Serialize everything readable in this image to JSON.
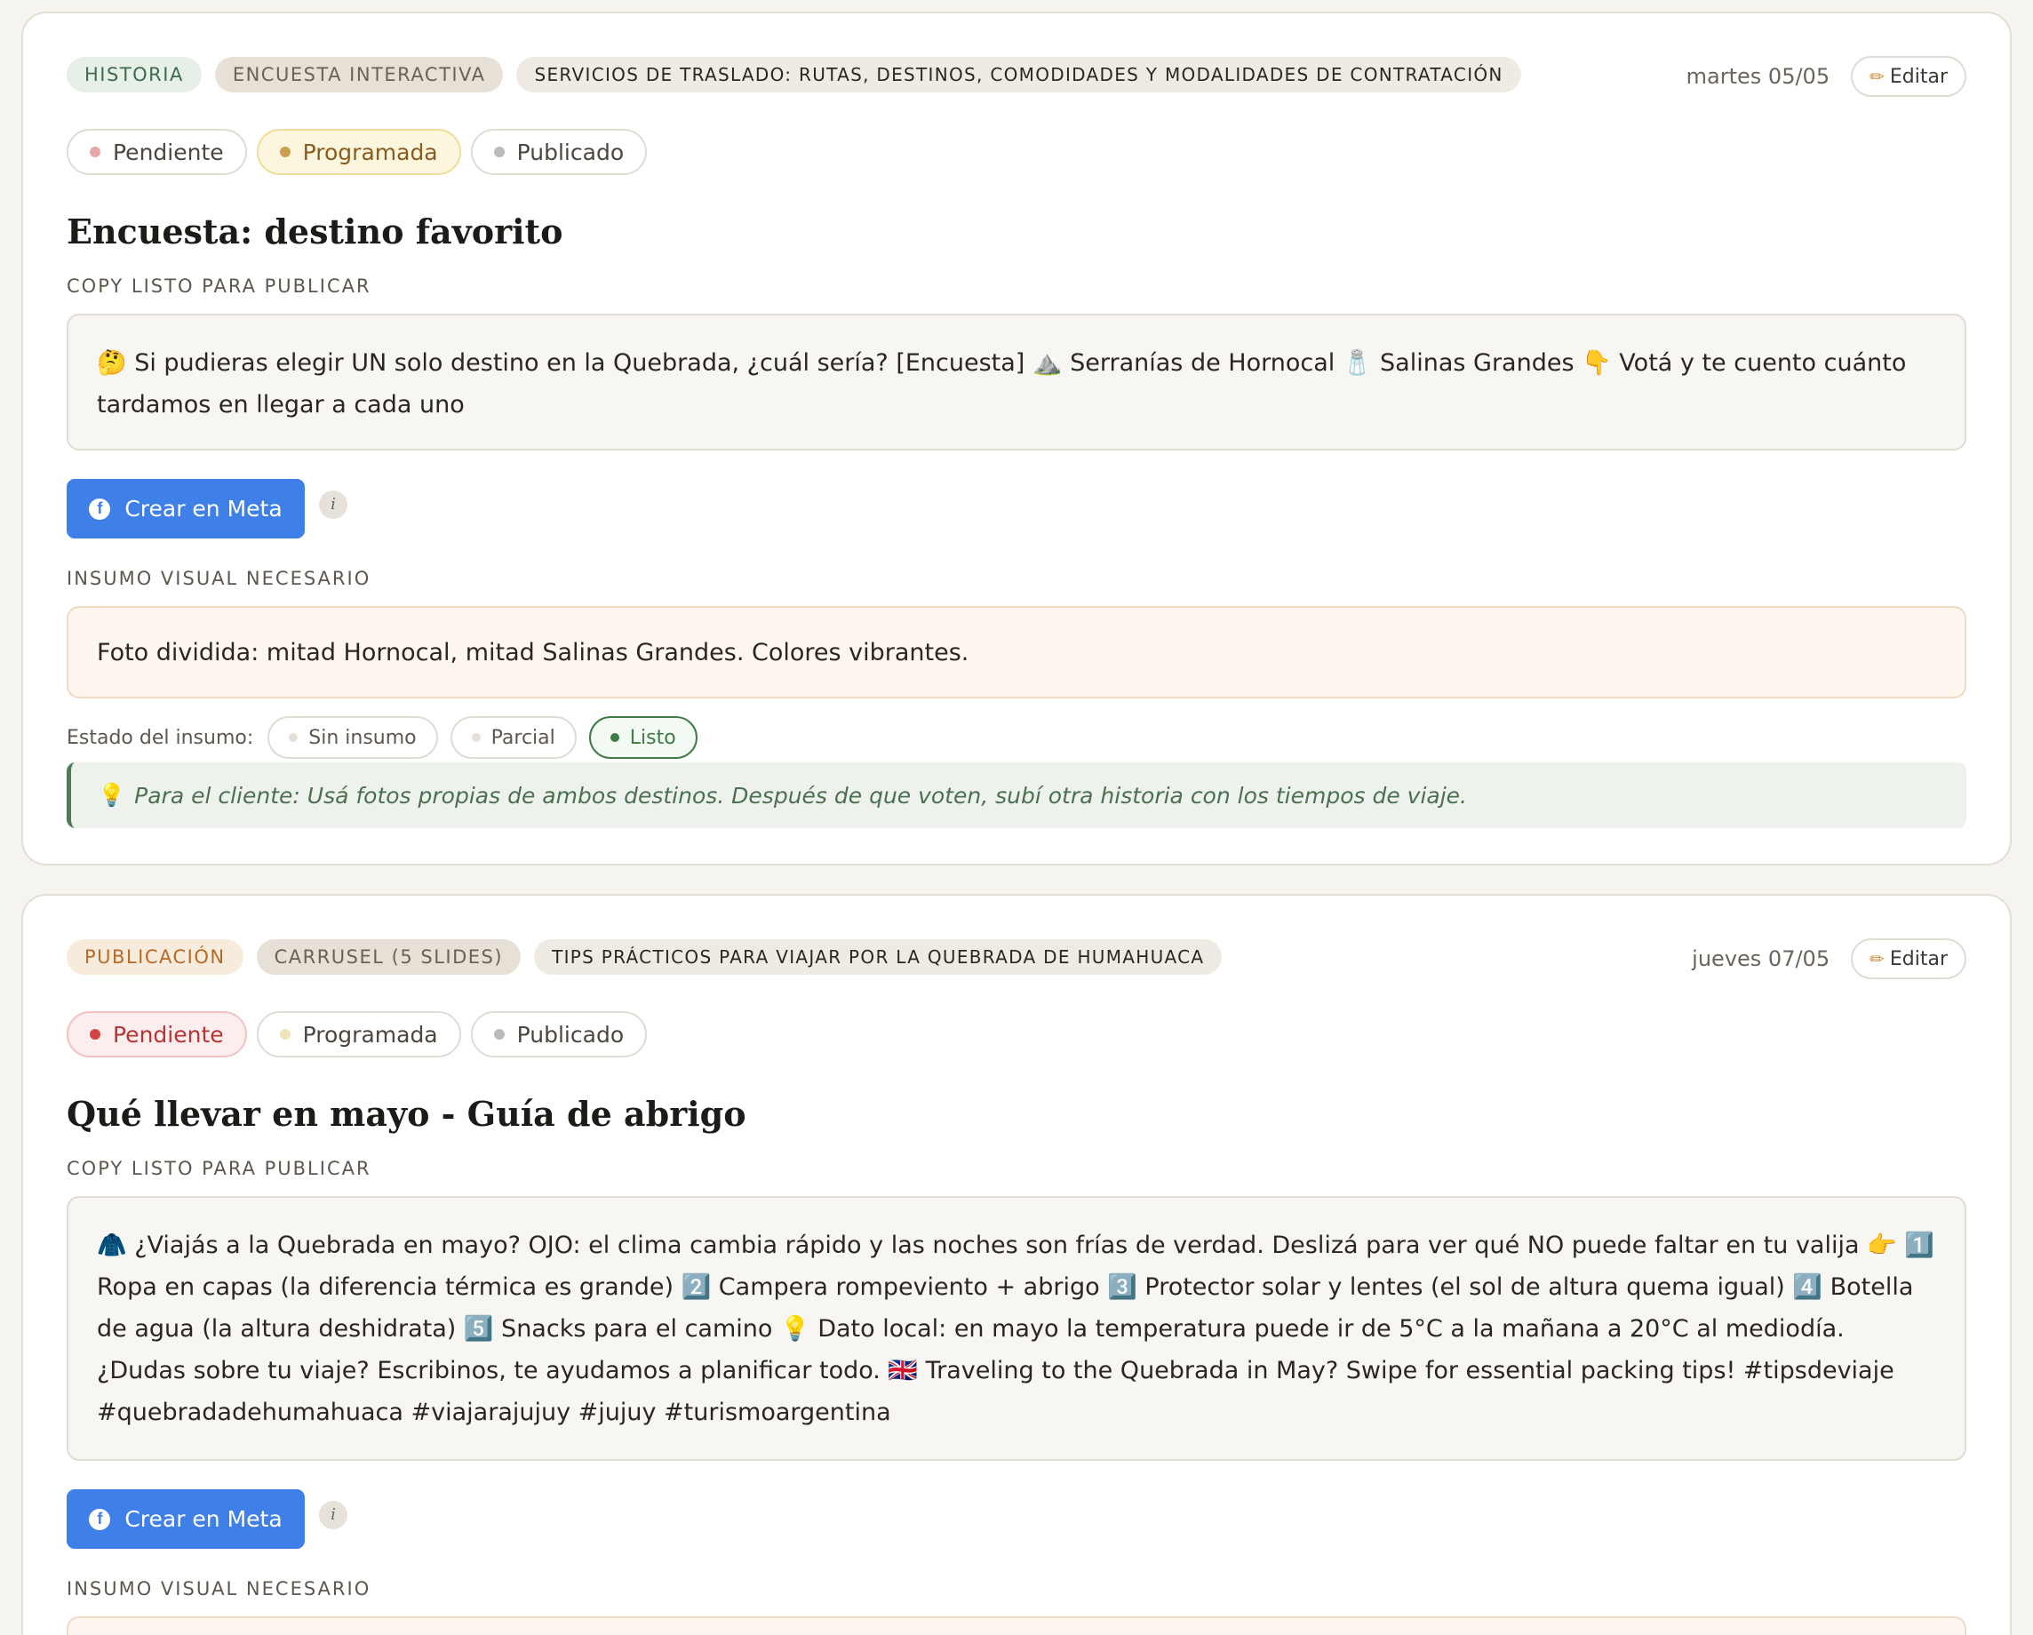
{
  "cards": [
    {
      "tags": [
        "HISTORIA",
        "ENCUESTA INTERACTIVA",
        "SERVICIOS DE TRASLADO: RUTAS, DESTINOS, COMODIDADES Y MODALIDADES DE CONTRATACIÓN"
      ],
      "date": "martes 05/05",
      "edit_label": "Editar",
      "statuses": [
        "Pendiente",
        "Programada",
        "Publicado"
      ],
      "active_status": "Programada",
      "title": "Encuesta: destino favorito",
      "copy_label": "COPY LISTO PARA PUBLICAR",
      "copy_text": "🤔 Si pudieras elegir UN solo destino en la Quebrada, ¿cuál sería? [Encuesta] ⛰️ Serranías de Hornocal 🧂 Salinas Grandes 👇 Votá y te cuento cuánto tardamos en llegar a cada uno",
      "meta_button": "Crear en Meta",
      "visual_label": "INSUMO VISUAL NECESARIO",
      "visual_text": "Foto dividida: mitad Hornocal, mitad Salinas Grandes. Colores vibrantes.",
      "estado_label": "Estado del insumo:",
      "estado_options": [
        "Sin insumo",
        "Parcial",
        "Listo"
      ],
      "estado_active": "Listo",
      "tip_text": "Para el cliente: Usá fotos propias de ambos destinos. Después de que voten, subí otra historia con los tiempos de viaje."
    },
    {
      "tags": [
        "PUBLICACIÓN",
        "CARRUSEL (5 SLIDES)",
        "TIPS PRÁCTICOS PARA VIAJAR POR LA QUEBRADA DE HUMAHUACA"
      ],
      "date": "jueves 07/05",
      "edit_label": "Editar",
      "statuses": [
        "Pendiente",
        "Programada",
        "Publicado"
      ],
      "active_status": "Pendiente",
      "title": "Qué llevar en mayo - Guía de abrigo",
      "copy_label": "COPY LISTO PARA PUBLICAR",
      "copy_text": "🧥 ¿Viajás a la Quebrada en mayo? OJO: el clima cambia rápido y las noches son frías de verdad. Deslizá para ver qué NO puede faltar en tu valija 👉 1️⃣ Ropa en capas (la diferencia térmica es grande) 2️⃣ Campera rompeviento + abrigo 3️⃣ Protector solar y lentes (el sol de altura quema igual) 4️⃣ Botella de agua (la altura deshidrata) 5️⃣ Snacks para el camino 💡 Dato local: en mayo la temperatura puede ir de 5°C a la mañana a 20°C al mediodía. ¿Dudas sobre tu viaje? Escribinos, te ayudamos a planificar todo. 🇬🇧 Traveling to the Quebrada in May? Swipe for essential packing tips! #tipsdeviaje #quebradadehumahuaca #viajarajujuy #jujuy #turismoargentina",
      "meta_button": "Crear en Meta",
      "visual_label": "INSUMO VISUAL NECESARIO"
    }
  ],
  "colors": {
    "pendiente_dot": "#e8a6a6",
    "pendiente_dot_active": "#d24545",
    "programada_dot": "#c9a14e",
    "programada_dot_inactive": "#f1e3b8",
    "publicado_dot": "#b8bdb8",
    "meta_blue": "#3f7fe8",
    "listo_green": "#3f7a47"
  },
  "icons": {
    "edit": "pencil-icon",
    "meta": "facebook-icon",
    "info": "info-icon",
    "tip": "lightbulb-icon"
  }
}
